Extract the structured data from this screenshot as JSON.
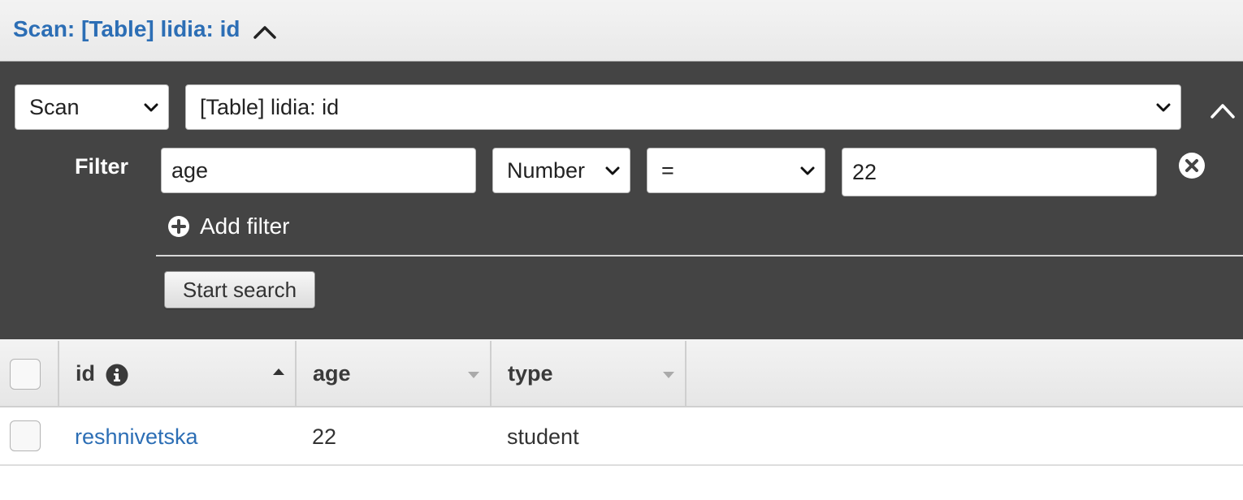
{
  "header": {
    "title": "Scan: [Table] lidia: id"
  },
  "query": {
    "mode": "Scan",
    "target": "[Table] lidia: id"
  },
  "filter": {
    "label": "Filter",
    "attribute": "age",
    "type": "Number",
    "operator": "=",
    "value": "22",
    "add_label": "Add filter"
  },
  "start_button": "Start search",
  "table": {
    "columns": [
      {
        "label": "id",
        "sort": "ascending",
        "info_icon": "info-icon"
      },
      {
        "label": "age",
        "sort": "none"
      },
      {
        "label": "type",
        "sort": "none"
      }
    ],
    "rows": [
      {
        "id": "reshnivetska",
        "age": "22",
        "type": "student"
      }
    ]
  },
  "colors": {
    "accent": "#2c6eb5",
    "panel": "#444444",
    "header_bg": "#efefef"
  }
}
